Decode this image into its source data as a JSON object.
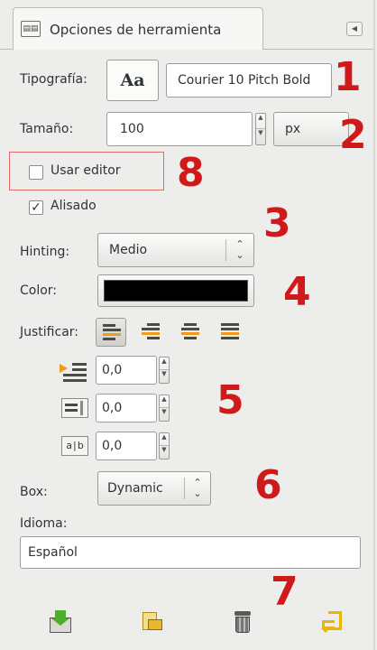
{
  "tab": {
    "title": "Opciones de herramienta"
  },
  "typography": {
    "label": "Tipografía:",
    "preview": "Aa",
    "font": "Courier 10 Pitch Bold"
  },
  "size": {
    "label": "Tamaño:",
    "value": "100",
    "unit": "px"
  },
  "use_editor": {
    "label": "Usar editor",
    "checked": false
  },
  "antialias": {
    "label": "Alisado",
    "checked": true
  },
  "hinting": {
    "label": "Hinting:",
    "value": "Medio"
  },
  "color": {
    "label": "Color:",
    "value": "#000000"
  },
  "justify": {
    "label": "Justificar:",
    "options": [
      "left",
      "right",
      "center",
      "fill"
    ],
    "selected": "left"
  },
  "indent": {
    "value": "0,0"
  },
  "line_spacing": {
    "value": "0,0"
  },
  "letter_spacing": {
    "value": "0,0"
  },
  "box": {
    "label": "Box:",
    "value": "Dynamic"
  },
  "language": {
    "label": "Idioma:",
    "value": "Español"
  },
  "annotations": [
    "1",
    "2",
    "3",
    "4",
    "5",
    "6",
    "7",
    "8"
  ],
  "bottom_tools": [
    "save-preset-icon",
    "restore-preset-icon",
    "delete-preset-icon",
    "reset-icon"
  ]
}
